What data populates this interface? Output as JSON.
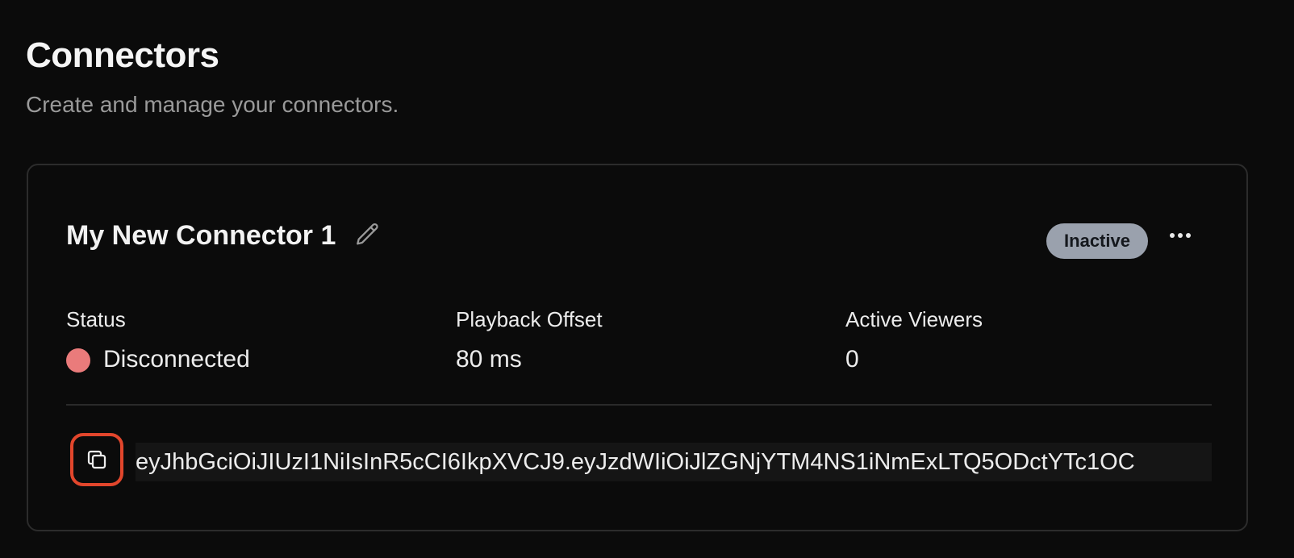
{
  "header": {
    "title": "Connectors",
    "subtitle": "Create and manage your connectors."
  },
  "connector": {
    "name": "My New Connector 1",
    "badge": "Inactive",
    "stats": {
      "status_label": "Status",
      "status_value": "Disconnected",
      "playback_label": "Playback Offset",
      "playback_value": "80 ms",
      "viewers_label": "Active Viewers",
      "viewers_value": "0"
    },
    "token": "eyJhbGciOiJIUzI1NiIsInR5cCI6IkpXVCJ9.eyJzdWIiOiJlZGNjYTM4NS1iNmExLTQ5ODctYTc1OC"
  },
  "colors": {
    "background": "#0b0b0b",
    "card_border": "#2c2c2c",
    "badge_bg": "#9aa1ad",
    "status_disconnected": "#ea7b7b",
    "highlight_ring": "#e2462c"
  },
  "icons": {
    "edit": "pencil-icon",
    "more": "more-horizontal-icon",
    "copy": "copy-icon",
    "status": "status-dot"
  }
}
